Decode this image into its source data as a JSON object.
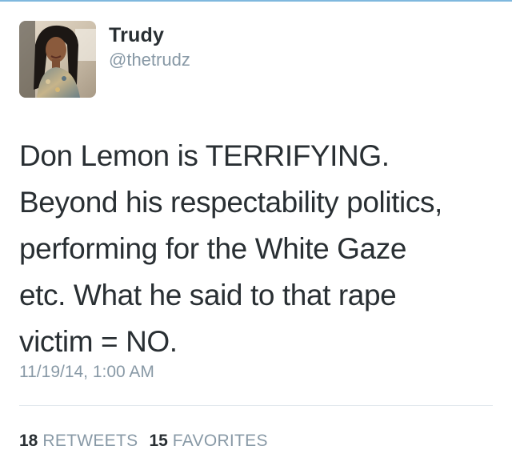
{
  "tweet": {
    "author": {
      "display_name": "Trudy",
      "handle": "@thetrudz"
    },
    "text": "Don Lemon is TERRIFYING.\nBeyond his respectability politics,\nperforming for the White Gaze\netc. What he said to that rape\nvictim = NO.",
    "timestamp": "11/19/14, 1:00 AM",
    "stats": {
      "retweets_count": "18",
      "retweets_label": "RETWEETS",
      "favorites_count": "15",
      "favorites_label": "FAVORITES"
    }
  },
  "colors": {
    "text_primary": "#292f33",
    "text_secondary": "#8899a6",
    "divider": "#e1e8ed",
    "top_rule": "#7fb8de"
  }
}
